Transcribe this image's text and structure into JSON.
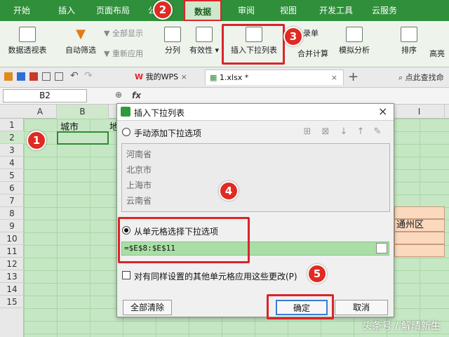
{
  "menu": {
    "tabs": [
      "开始",
      "插入",
      "页面布局",
      "公",
      "数据",
      "审阅",
      "视图",
      "开发工具",
      "云服务"
    ]
  },
  "ribbon": {
    "pivot": "数据透视表",
    "autofilter": "自动筛选",
    "show_all": "全部显示",
    "reapply": "重新应用",
    "split": "分列",
    "validity": "有效性",
    "insert_dropdown": "插入下拉列表",
    "record": "录单",
    "merge_calc": "合并计算",
    "simulate": "模拟分析",
    "sort": "排序",
    "highlight": "高亮"
  },
  "file_tabs": {
    "my_wps": "我的WPS",
    "file": "1.xlsx *",
    "search_hint": "点此查找命"
  },
  "formula_bar": {
    "name_box": "B2",
    "fx": "fx"
  },
  "columns": [
    "A",
    "B",
    "",
    "",
    "",
    "",
    "",
    "",
    "",
    "I"
  ],
  "rows": [
    "1",
    "2",
    "3",
    "4",
    "5",
    "6",
    "7",
    "8",
    "9",
    "10",
    "11",
    "12",
    "13",
    "14",
    "15"
  ],
  "cells": {
    "b1": "城市",
    "c1_partial": "地",
    "i9": "通州区"
  },
  "dialog": {
    "title": "插入下拉列表",
    "manual_option": "手动添加下拉选项",
    "items": [
      "河南省",
      "北京市",
      "上海市",
      "云南省"
    ],
    "from_cell_option": "从单元格选择下拉选项",
    "source_ref": "=$E$8:$E$11",
    "apply_checkbox": "对有同样设置的其他单元格应用这些更改(P)",
    "clear_all": "全部清除",
    "ok": "确定",
    "cancel": "取消"
  },
  "badges": [
    "1",
    "2",
    "3",
    "4",
    "5"
  ],
  "watermark": "头条号 / 解晴新生",
  "colors": {
    "menubar": "#2f8f3a",
    "sheet_bg": "#c6e7c4",
    "highlight_red": "#d9252a",
    "badge": "#e02a22"
  }
}
